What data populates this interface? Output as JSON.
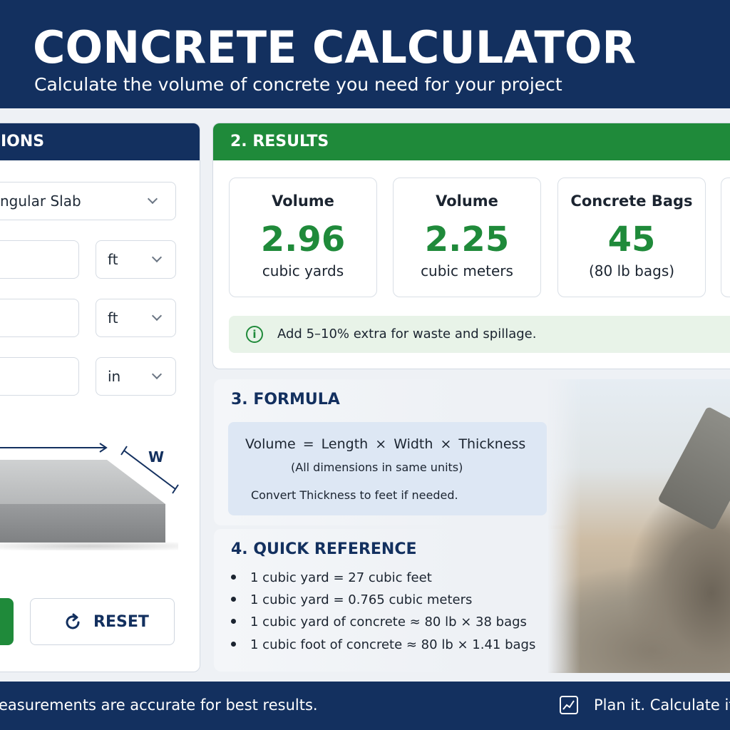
{
  "header": {
    "title": "CONCRETE CALCULATOR",
    "subtitle": "Calculate the volume of concrete you need for your project"
  },
  "dimensions": {
    "header_label": "IONS",
    "shape_value": "ngular Slab",
    "length_unit": "ft",
    "width_unit": "ft",
    "thickness_unit": "in",
    "diagram_w_label": "W",
    "reset_label": "RESET"
  },
  "results": {
    "title": "2. RESULTS",
    "cards": [
      {
        "label": "Volume",
        "value": "2.96",
        "unit": "cubic yards"
      },
      {
        "label": "Volume",
        "value": "2.25",
        "unit": "cubic meters"
      },
      {
        "label": "Concrete Bags",
        "value": "45",
        "unit": "(80 lb bags)"
      }
    ],
    "tip_icon": "i",
    "tip": "Add 5–10% extra for waste and spillage."
  },
  "formula": {
    "title": "3. FORMULA",
    "main": "Volume = Length × Width × Thickness",
    "note": "(All dimensions in same units)",
    "convert": "Convert Thickness to feet if needed."
  },
  "reference": {
    "title": "4. QUICK REFERENCE",
    "items": [
      "1 cubic yard = 27 cubic feet",
      "1 cubic yard = 0.765 cubic meters",
      "1 cubic yard of concrete ≈ 80 lb × 38 bags",
      "1 cubic foot of concrete ≈ 80 lb × 1.41 bags"
    ]
  },
  "footer": {
    "left": "easurements are accurate for best results.",
    "right": "Plan it. Calculate it."
  },
  "colors": {
    "navy": "#13305f",
    "green": "#1f8a3a"
  }
}
